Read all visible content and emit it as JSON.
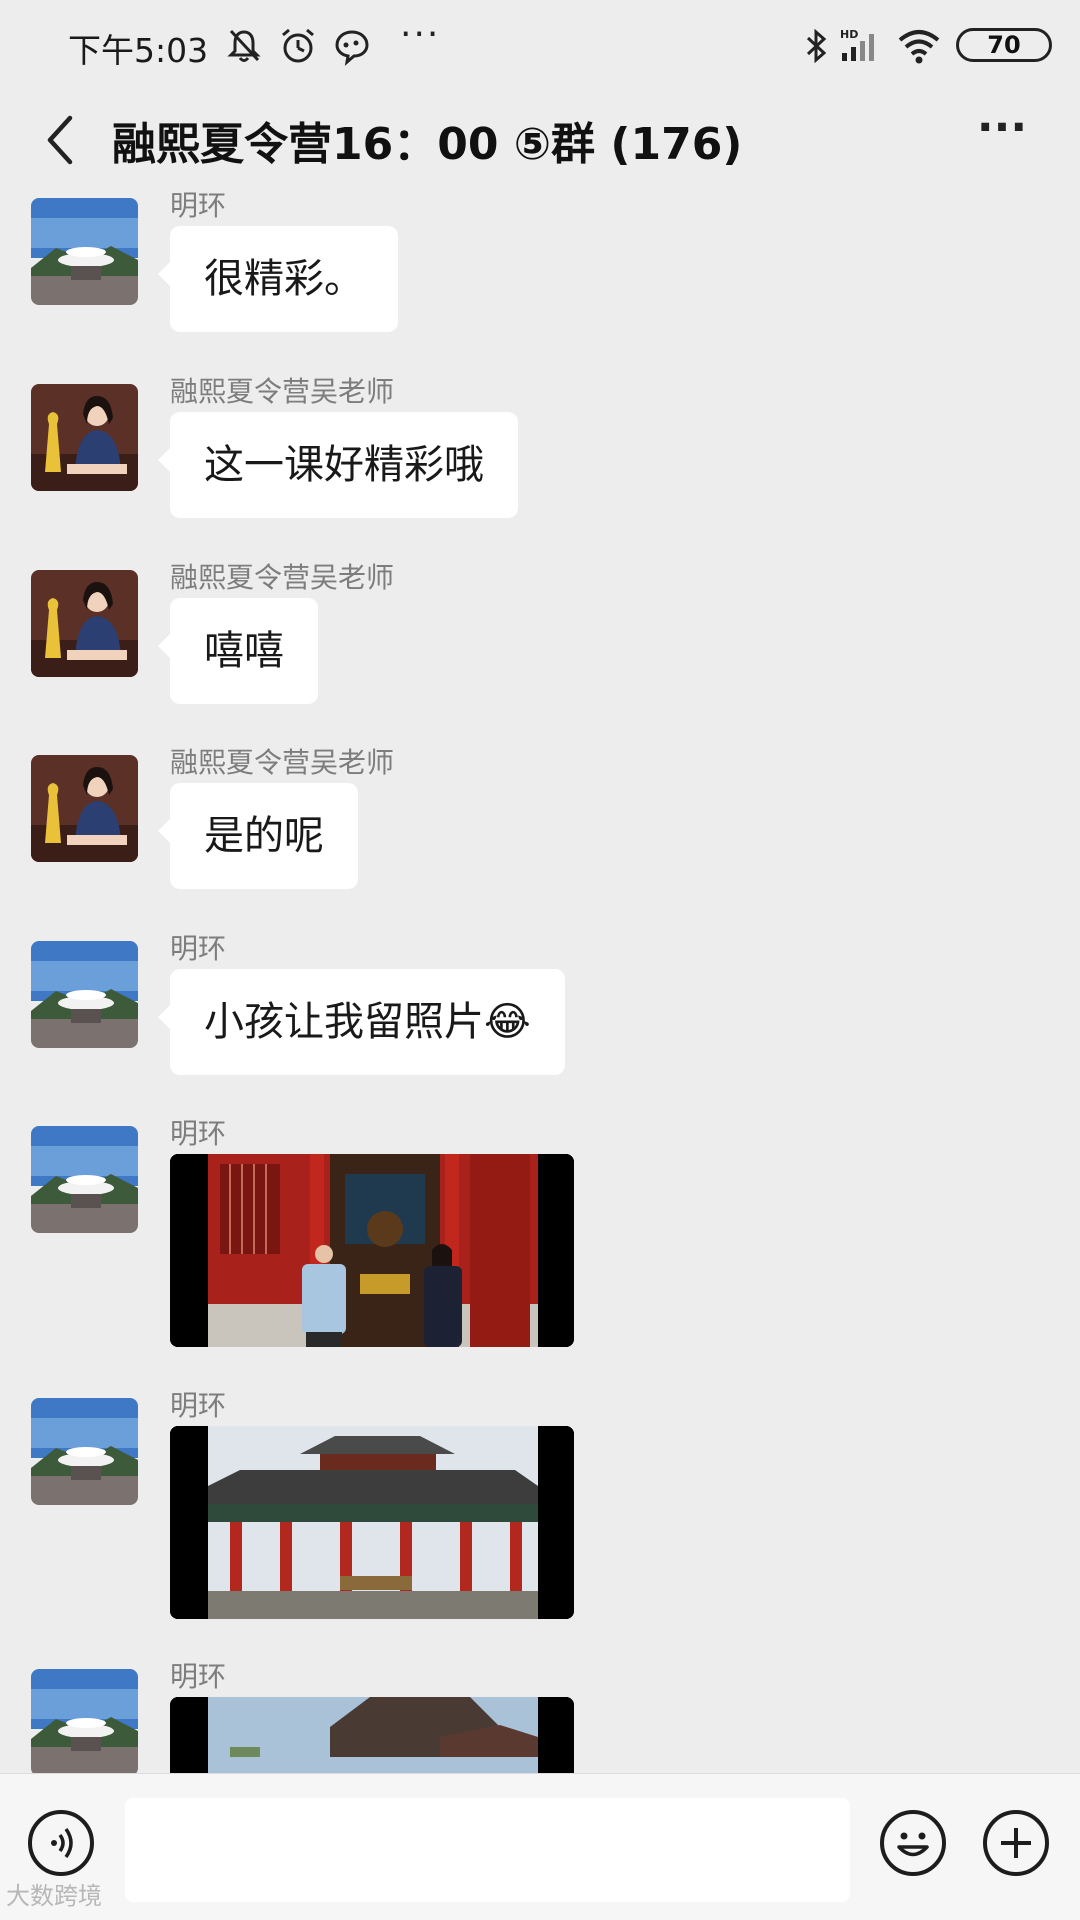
{
  "status_bar": {
    "time": "下午5:03",
    "more": "···",
    "battery": "70",
    "icons": [
      "bell-muted-icon",
      "alarm-icon",
      "chat-notification-icon",
      "bluetooth-icon",
      "hd-signal-icon",
      "wifi-icon",
      "battery-icon"
    ]
  },
  "header": {
    "title": "融熙夏令营16：00 ⑤群 (176)",
    "back_icon": "chevron-left-icon",
    "more_icon": "more-dots-icon",
    "more": "···"
  },
  "messages": [
    {
      "sender": "明环",
      "avatar": "temple-avatar",
      "type": "text",
      "text": "很精彩。"
    },
    {
      "sender": "融熙夏令营吴老师",
      "avatar": "teacher-avatar",
      "type": "text",
      "text": "这一课好精彩哦"
    },
    {
      "sender": "融熙夏令营吴老师",
      "avatar": "teacher-avatar",
      "type": "text",
      "text": "嘻嘻"
    },
    {
      "sender": "融熙夏令营吴老师",
      "avatar": "teacher-avatar",
      "type": "text",
      "text": "是的呢"
    },
    {
      "sender": "明环",
      "avatar": "temple-avatar",
      "type": "text",
      "text": "小孩让我留照片😂"
    },
    {
      "sender": "明环",
      "avatar": "temple-avatar",
      "type": "image",
      "image": "temple-hall-photo"
    },
    {
      "sender": "明环",
      "avatar": "temple-avatar",
      "type": "image",
      "image": "pavilion-photo"
    },
    {
      "sender": "明环",
      "avatar": "temple-avatar",
      "type": "image",
      "image": "roof-photo"
    }
  ],
  "input_bar": {
    "voice_icon": "voice-icon",
    "emoji_icon": "emoji-icon",
    "plus_icon": "plus-icon",
    "input_value": ""
  },
  "watermark": "大数跨境",
  "colors": {
    "background": "#ededed",
    "bubble": "#ffffff",
    "sender_name": "#7d7d7d",
    "text": "#191919"
  }
}
